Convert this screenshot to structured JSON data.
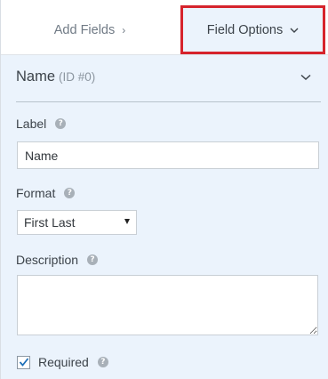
{
  "tabs": {
    "add_fields": "Add Fields",
    "add_fields_chevron": "›",
    "field_options": "Field Options",
    "field_options_chevron": "chevron-down-icon"
  },
  "field": {
    "name": "Name",
    "id_text": "(ID #0)"
  },
  "label_field": {
    "label": "Label",
    "value": "Name"
  },
  "format_field": {
    "label": "Format",
    "selected": "First Last"
  },
  "description_field": {
    "label": "Description",
    "value": ""
  },
  "required_field": {
    "label": "Required",
    "checked": true
  },
  "colors": {
    "panel_bg": "#ebf3fc",
    "highlight_border": "#d6232c",
    "text": "#3c434a",
    "muted_text": "#707a85"
  }
}
